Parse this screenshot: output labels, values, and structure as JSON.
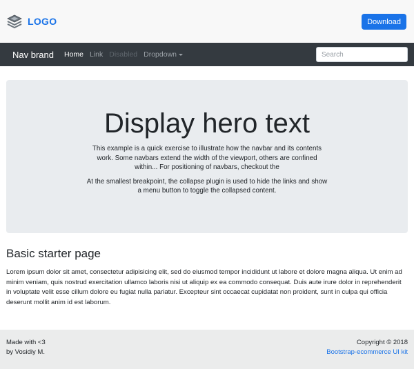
{
  "header": {
    "logo_text": "LOGO",
    "download_label": "Download"
  },
  "navbar": {
    "brand": "Nav brand",
    "links": [
      {
        "label": "Home"
      },
      {
        "label": "Link"
      },
      {
        "label": "Disabled"
      },
      {
        "label": "Dropdown"
      }
    ],
    "search_placeholder": "Search"
  },
  "hero": {
    "title": "Display hero text",
    "lead": "This example is a quick exercise to illustrate how the navbar and its contents work. Some navbars extend the width of the viewport, others are confined within... For positioning of navbars, checkout the",
    "lead2": "At the smallest breakpoint, the collapse plugin is used to hide the links and show a menu button to toggle the collapsed content."
  },
  "main": {
    "heading": "Basic starter page",
    "paragraph": "Lorem ipsum dolor sit amet, consectetur adipisicing elit, sed do eiusmod tempor incididunt ut labore et dolore magna aliqua. Ut enim ad minim veniam, quis nostrud exercitation ullamco laboris nisi ut aliquip ex ea commodo consequat. Duis aute irure dolor in reprehenderit in voluptate velit esse cillum dolore eu fugiat nulla pariatur. Excepteur sint occaecat cupidatat non proident, sunt in culpa qui officia deserunt mollit anim id est laborum."
  },
  "footer": {
    "made_with": "Made with <3",
    "by": "by Vosidiy M.",
    "copyright": "Copyright © 2018",
    "link": "Bootstrap-ecommerce UI kit"
  },
  "colors": {
    "accent": "#1a73e8",
    "navbar_bg": "#343a40",
    "hero_bg": "#e9ecef",
    "footer_bg": "#ebecec"
  },
  "icons": {
    "logo": "layers-icon",
    "dropdown": "caret-down-icon"
  }
}
